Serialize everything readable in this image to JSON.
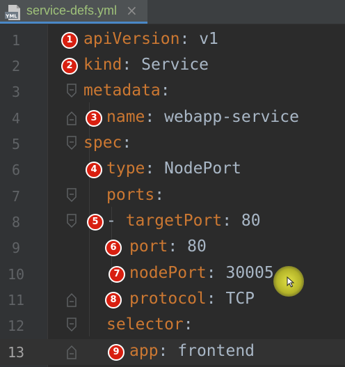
{
  "tab": {
    "filename": "service-defs.yml",
    "icon": "yml-file-icon",
    "icon_text": "YML",
    "close": "×"
  },
  "lines": [
    {
      "number": "1",
      "key": "apiVersion",
      "sep": ": ",
      "value": "v1",
      "badge": "1"
    },
    {
      "number": "2",
      "key": "kind",
      "sep": ": ",
      "value": "Service",
      "badge": "2"
    },
    {
      "number": "3",
      "key": "metadata",
      "sep": ":",
      "value": "",
      "badge": ""
    },
    {
      "number": "4",
      "key": "name",
      "sep": ": ",
      "value": "webapp-service",
      "badge": "3"
    },
    {
      "number": "5",
      "key": "spec",
      "sep": ":",
      "value": "",
      "badge": ""
    },
    {
      "number": "6",
      "key": "type",
      "sep": ": ",
      "value": "NodePort",
      "badge": "4"
    },
    {
      "number": "7",
      "key": "ports",
      "sep": ":",
      "value": "",
      "badge": ""
    },
    {
      "number": "8",
      "prefix": "- ",
      "key": "targetPort",
      "sep": ": ",
      "value": "80",
      "badge": "5"
    },
    {
      "number": "9",
      "key": "port",
      "sep": ": ",
      "value": "80",
      "badge": "6"
    },
    {
      "number": "10",
      "key": "nodePort",
      "sep": ": ",
      "value": "30005",
      "badge": "7"
    },
    {
      "number": "11",
      "key": "protocol",
      "sep": ": ",
      "value": "TCP",
      "badge": "8"
    },
    {
      "number": "12",
      "key": "selector",
      "sep": ":",
      "value": "",
      "badge": ""
    },
    {
      "number": "13",
      "key": "app",
      "sep": ": ",
      "value": "frontend",
      "badge": "9"
    }
  ],
  "current_line": "13",
  "colors": {
    "key": "#cc7832",
    "value": "#a9b7c6",
    "badge": "#d81f10",
    "filename": "#9fc27a",
    "cursor_highlight": "#ebeb46"
  }
}
